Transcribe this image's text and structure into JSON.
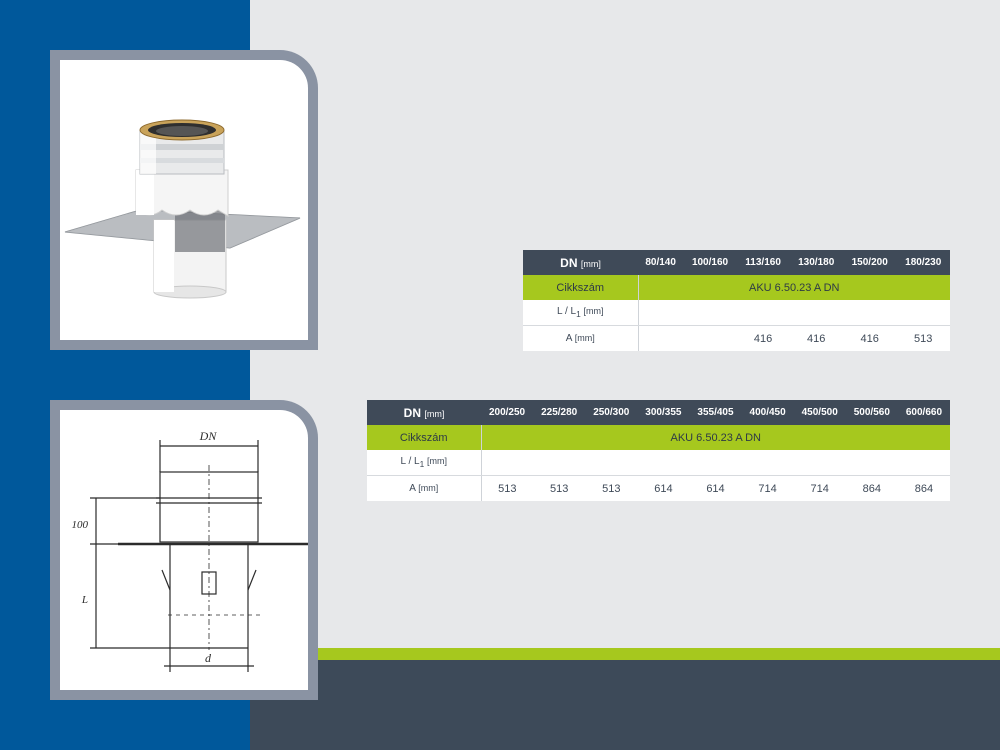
{
  "table1": {
    "header_label": "DN",
    "header_unit": "[mm]",
    "columns": [
      "80/140",
      "100/160",
      "113/160",
      "130/180",
      "150/200",
      "180/230"
    ],
    "code_label": "Cikkszám",
    "code_value": "AKU 6.50.23 A DN",
    "l_label": "L / L",
    "l_sub": "1",
    "l_unit": "[mm]",
    "a_label": "A",
    "a_unit": "[mm]",
    "a_values": [
      "",
      "",
      "416",
      "416",
      "416",
      "513"
    ]
  },
  "table2": {
    "header_label": "DN",
    "header_unit": "[mm]",
    "columns": [
      "200/250",
      "225/280",
      "250/300",
      "300/355",
      "355/405",
      "400/450",
      "450/500",
      "500/560",
      "600/660"
    ],
    "code_label": "Cikkszám",
    "code_value": "AKU 6.50.23 A DN",
    "l_label": "L / L",
    "l_sub": "1",
    "l_unit": "[mm]",
    "a_label": "A",
    "a_unit": "[mm]",
    "a_values": [
      "513",
      "513",
      "513",
      "614",
      "614",
      "714",
      "714",
      "864",
      "864"
    ]
  },
  "drawing": {
    "dim_top": "DN",
    "dim_bottom": "d",
    "dim_left_upper": "100",
    "dim_left_lower": "L"
  }
}
